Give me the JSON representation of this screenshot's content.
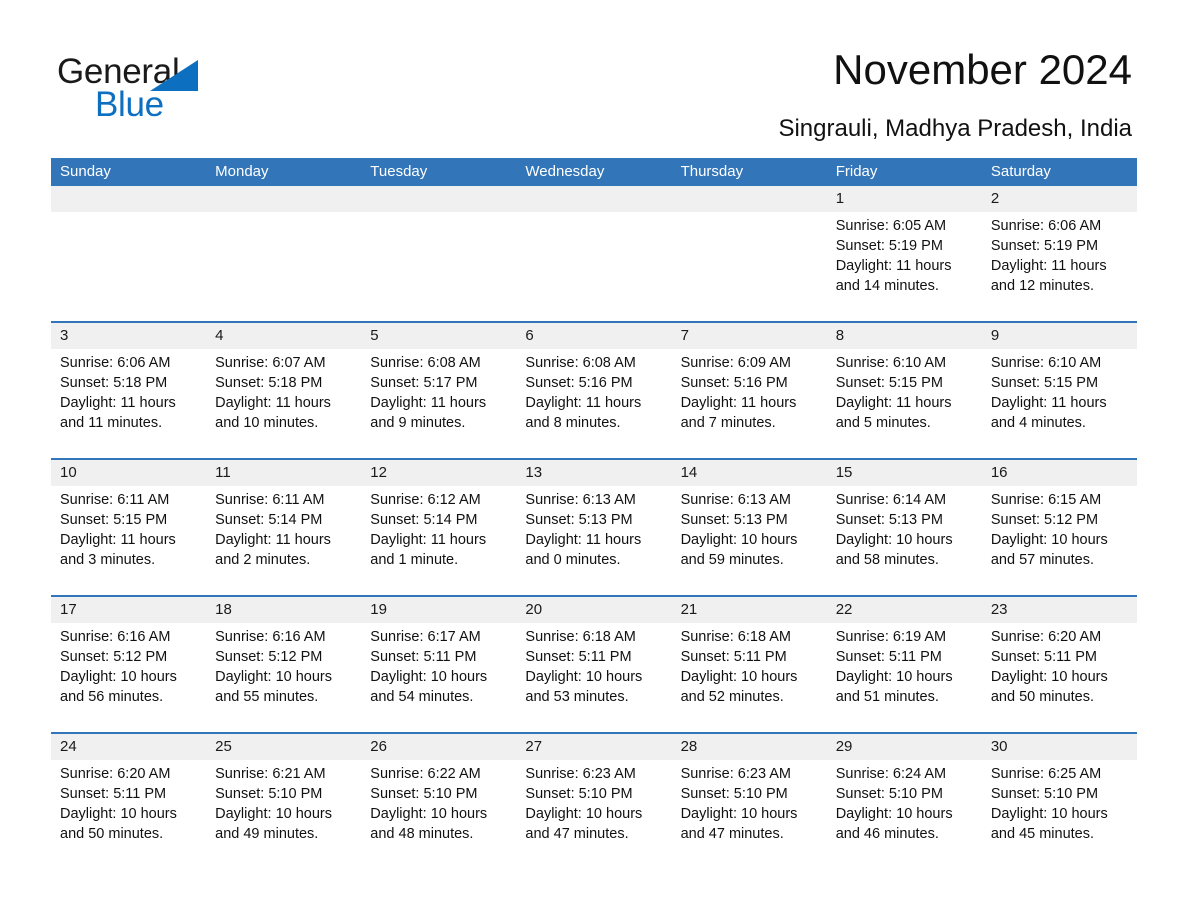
{
  "brand": {
    "name_part1": "General",
    "name_part2": "Blue",
    "accent_color": "#0d6fc0"
  },
  "header": {
    "title": "November 2024",
    "location": "Singrauli, Madhya Pradesh, India"
  },
  "calendar": {
    "header_color": "#3275b8",
    "weekdays": [
      "Sunday",
      "Monday",
      "Tuesday",
      "Wednesday",
      "Thursday",
      "Friday",
      "Saturday"
    ],
    "weeks": [
      [
        {
          "date": ""
        },
        {
          "date": ""
        },
        {
          "date": ""
        },
        {
          "date": ""
        },
        {
          "date": ""
        },
        {
          "date": "1",
          "sunrise": "Sunrise: 6:05 AM",
          "sunset": "Sunset: 5:19 PM",
          "daylight": "Daylight: 11 hours and 14 minutes."
        },
        {
          "date": "2",
          "sunrise": "Sunrise: 6:06 AM",
          "sunset": "Sunset: 5:19 PM",
          "daylight": "Daylight: 11 hours and 12 minutes."
        }
      ],
      [
        {
          "date": "3",
          "sunrise": "Sunrise: 6:06 AM",
          "sunset": "Sunset: 5:18 PM",
          "daylight": "Daylight: 11 hours and 11 minutes."
        },
        {
          "date": "4",
          "sunrise": "Sunrise: 6:07 AM",
          "sunset": "Sunset: 5:18 PM",
          "daylight": "Daylight: 11 hours and 10 minutes."
        },
        {
          "date": "5",
          "sunrise": "Sunrise: 6:08 AM",
          "sunset": "Sunset: 5:17 PM",
          "daylight": "Daylight: 11 hours and 9 minutes."
        },
        {
          "date": "6",
          "sunrise": "Sunrise: 6:08 AM",
          "sunset": "Sunset: 5:16 PM",
          "daylight": "Daylight: 11 hours and 8 minutes."
        },
        {
          "date": "7",
          "sunrise": "Sunrise: 6:09 AM",
          "sunset": "Sunset: 5:16 PM",
          "daylight": "Daylight: 11 hours and 7 minutes."
        },
        {
          "date": "8",
          "sunrise": "Sunrise: 6:10 AM",
          "sunset": "Sunset: 5:15 PM",
          "daylight": "Daylight: 11 hours and 5 minutes."
        },
        {
          "date": "9",
          "sunrise": "Sunrise: 6:10 AM",
          "sunset": "Sunset: 5:15 PM",
          "daylight": "Daylight: 11 hours and 4 minutes."
        }
      ],
      [
        {
          "date": "10",
          "sunrise": "Sunrise: 6:11 AM",
          "sunset": "Sunset: 5:15 PM",
          "daylight": "Daylight: 11 hours and 3 minutes."
        },
        {
          "date": "11",
          "sunrise": "Sunrise: 6:11 AM",
          "sunset": "Sunset: 5:14 PM",
          "daylight": "Daylight: 11 hours and 2 minutes."
        },
        {
          "date": "12",
          "sunrise": "Sunrise: 6:12 AM",
          "sunset": "Sunset: 5:14 PM",
          "daylight": "Daylight: 11 hours and 1 minute."
        },
        {
          "date": "13",
          "sunrise": "Sunrise: 6:13 AM",
          "sunset": "Sunset: 5:13 PM",
          "daylight": "Daylight: 11 hours and 0 minutes."
        },
        {
          "date": "14",
          "sunrise": "Sunrise: 6:13 AM",
          "sunset": "Sunset: 5:13 PM",
          "daylight": "Daylight: 10 hours and 59 minutes."
        },
        {
          "date": "15",
          "sunrise": "Sunrise: 6:14 AM",
          "sunset": "Sunset: 5:13 PM",
          "daylight": "Daylight: 10 hours and 58 minutes."
        },
        {
          "date": "16",
          "sunrise": "Sunrise: 6:15 AM",
          "sunset": "Sunset: 5:12 PM",
          "daylight": "Daylight: 10 hours and 57 minutes."
        }
      ],
      [
        {
          "date": "17",
          "sunrise": "Sunrise: 6:16 AM",
          "sunset": "Sunset: 5:12 PM",
          "daylight": "Daylight: 10 hours and 56 minutes."
        },
        {
          "date": "18",
          "sunrise": "Sunrise: 6:16 AM",
          "sunset": "Sunset: 5:12 PM",
          "daylight": "Daylight: 10 hours and 55 minutes."
        },
        {
          "date": "19",
          "sunrise": "Sunrise: 6:17 AM",
          "sunset": "Sunset: 5:11 PM",
          "daylight": "Daylight: 10 hours and 54 minutes."
        },
        {
          "date": "20",
          "sunrise": "Sunrise: 6:18 AM",
          "sunset": "Sunset: 5:11 PM",
          "daylight": "Daylight: 10 hours and 53 minutes."
        },
        {
          "date": "21",
          "sunrise": "Sunrise: 6:18 AM",
          "sunset": "Sunset: 5:11 PM",
          "daylight": "Daylight: 10 hours and 52 minutes."
        },
        {
          "date": "22",
          "sunrise": "Sunrise: 6:19 AM",
          "sunset": "Sunset: 5:11 PM",
          "daylight": "Daylight: 10 hours and 51 minutes."
        },
        {
          "date": "23",
          "sunrise": "Sunrise: 6:20 AM",
          "sunset": "Sunset: 5:11 PM",
          "daylight": "Daylight: 10 hours and 50 minutes."
        }
      ],
      [
        {
          "date": "24",
          "sunrise": "Sunrise: 6:20 AM",
          "sunset": "Sunset: 5:11 PM",
          "daylight": "Daylight: 10 hours and 50 minutes."
        },
        {
          "date": "25",
          "sunrise": "Sunrise: 6:21 AM",
          "sunset": "Sunset: 5:10 PM",
          "daylight": "Daylight: 10 hours and 49 minutes."
        },
        {
          "date": "26",
          "sunrise": "Sunrise: 6:22 AM",
          "sunset": "Sunset: 5:10 PM",
          "daylight": "Daylight: 10 hours and 48 minutes."
        },
        {
          "date": "27",
          "sunrise": "Sunrise: 6:23 AM",
          "sunset": "Sunset: 5:10 PM",
          "daylight": "Daylight: 10 hours and 47 minutes."
        },
        {
          "date": "28",
          "sunrise": "Sunrise: 6:23 AM",
          "sunset": "Sunset: 5:10 PM",
          "daylight": "Daylight: 10 hours and 47 minutes."
        },
        {
          "date": "29",
          "sunrise": "Sunrise: 6:24 AM",
          "sunset": "Sunset: 5:10 PM",
          "daylight": "Daylight: 10 hours and 46 minutes."
        },
        {
          "date": "30",
          "sunrise": "Sunrise: 6:25 AM",
          "sunset": "Sunset: 5:10 PM",
          "daylight": "Daylight: 10 hours and 45 minutes."
        }
      ]
    ]
  }
}
